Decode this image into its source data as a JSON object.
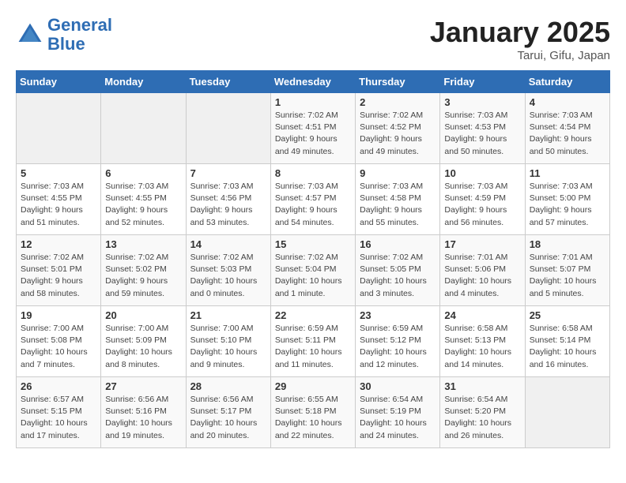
{
  "logo": {
    "line1": "General",
    "line2": "Blue"
  },
  "title": "January 2025",
  "subtitle": "Tarui, Gifu, Japan",
  "days_header": [
    "Sunday",
    "Monday",
    "Tuesday",
    "Wednesday",
    "Thursday",
    "Friday",
    "Saturday"
  ],
  "weeks": [
    [
      {
        "day": "",
        "info": ""
      },
      {
        "day": "",
        "info": ""
      },
      {
        "day": "",
        "info": ""
      },
      {
        "day": "1",
        "info": "Sunrise: 7:02 AM\nSunset: 4:51 PM\nDaylight: 9 hours and 49 minutes."
      },
      {
        "day": "2",
        "info": "Sunrise: 7:02 AM\nSunset: 4:52 PM\nDaylight: 9 hours and 49 minutes."
      },
      {
        "day": "3",
        "info": "Sunrise: 7:03 AM\nSunset: 4:53 PM\nDaylight: 9 hours and 50 minutes."
      },
      {
        "day": "4",
        "info": "Sunrise: 7:03 AM\nSunset: 4:54 PM\nDaylight: 9 hours and 50 minutes."
      }
    ],
    [
      {
        "day": "5",
        "info": "Sunrise: 7:03 AM\nSunset: 4:55 PM\nDaylight: 9 hours and 51 minutes."
      },
      {
        "day": "6",
        "info": "Sunrise: 7:03 AM\nSunset: 4:55 PM\nDaylight: 9 hours and 52 minutes."
      },
      {
        "day": "7",
        "info": "Sunrise: 7:03 AM\nSunset: 4:56 PM\nDaylight: 9 hours and 53 minutes."
      },
      {
        "day": "8",
        "info": "Sunrise: 7:03 AM\nSunset: 4:57 PM\nDaylight: 9 hours and 54 minutes."
      },
      {
        "day": "9",
        "info": "Sunrise: 7:03 AM\nSunset: 4:58 PM\nDaylight: 9 hours and 55 minutes."
      },
      {
        "day": "10",
        "info": "Sunrise: 7:03 AM\nSunset: 4:59 PM\nDaylight: 9 hours and 56 minutes."
      },
      {
        "day": "11",
        "info": "Sunrise: 7:03 AM\nSunset: 5:00 PM\nDaylight: 9 hours and 57 minutes."
      }
    ],
    [
      {
        "day": "12",
        "info": "Sunrise: 7:02 AM\nSunset: 5:01 PM\nDaylight: 9 hours and 58 minutes."
      },
      {
        "day": "13",
        "info": "Sunrise: 7:02 AM\nSunset: 5:02 PM\nDaylight: 9 hours and 59 minutes."
      },
      {
        "day": "14",
        "info": "Sunrise: 7:02 AM\nSunset: 5:03 PM\nDaylight: 10 hours and 0 minutes."
      },
      {
        "day": "15",
        "info": "Sunrise: 7:02 AM\nSunset: 5:04 PM\nDaylight: 10 hours and 1 minute."
      },
      {
        "day": "16",
        "info": "Sunrise: 7:02 AM\nSunset: 5:05 PM\nDaylight: 10 hours and 3 minutes."
      },
      {
        "day": "17",
        "info": "Sunrise: 7:01 AM\nSunset: 5:06 PM\nDaylight: 10 hours and 4 minutes."
      },
      {
        "day": "18",
        "info": "Sunrise: 7:01 AM\nSunset: 5:07 PM\nDaylight: 10 hours and 5 minutes."
      }
    ],
    [
      {
        "day": "19",
        "info": "Sunrise: 7:00 AM\nSunset: 5:08 PM\nDaylight: 10 hours and 7 minutes."
      },
      {
        "day": "20",
        "info": "Sunrise: 7:00 AM\nSunset: 5:09 PM\nDaylight: 10 hours and 8 minutes."
      },
      {
        "day": "21",
        "info": "Sunrise: 7:00 AM\nSunset: 5:10 PM\nDaylight: 10 hours and 9 minutes."
      },
      {
        "day": "22",
        "info": "Sunrise: 6:59 AM\nSunset: 5:11 PM\nDaylight: 10 hours and 11 minutes."
      },
      {
        "day": "23",
        "info": "Sunrise: 6:59 AM\nSunset: 5:12 PM\nDaylight: 10 hours and 12 minutes."
      },
      {
        "day": "24",
        "info": "Sunrise: 6:58 AM\nSunset: 5:13 PM\nDaylight: 10 hours and 14 minutes."
      },
      {
        "day": "25",
        "info": "Sunrise: 6:58 AM\nSunset: 5:14 PM\nDaylight: 10 hours and 16 minutes."
      }
    ],
    [
      {
        "day": "26",
        "info": "Sunrise: 6:57 AM\nSunset: 5:15 PM\nDaylight: 10 hours and 17 minutes."
      },
      {
        "day": "27",
        "info": "Sunrise: 6:56 AM\nSunset: 5:16 PM\nDaylight: 10 hours and 19 minutes."
      },
      {
        "day": "28",
        "info": "Sunrise: 6:56 AM\nSunset: 5:17 PM\nDaylight: 10 hours and 20 minutes."
      },
      {
        "day": "29",
        "info": "Sunrise: 6:55 AM\nSunset: 5:18 PM\nDaylight: 10 hours and 22 minutes."
      },
      {
        "day": "30",
        "info": "Sunrise: 6:54 AM\nSunset: 5:19 PM\nDaylight: 10 hours and 24 minutes."
      },
      {
        "day": "31",
        "info": "Sunrise: 6:54 AM\nSunset: 5:20 PM\nDaylight: 10 hours and 26 minutes."
      },
      {
        "day": "",
        "info": ""
      }
    ]
  ]
}
